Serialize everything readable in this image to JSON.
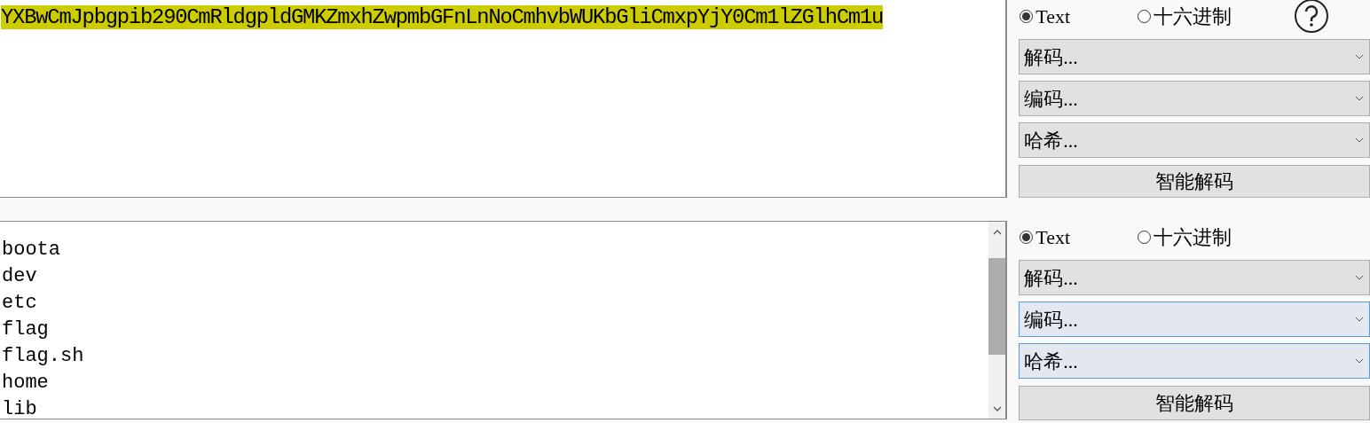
{
  "top_panel": {
    "input_text": "YXBwCmJpbgpib290CmRldgpldGMKZmxhZwpmbGFnLnNoCmhvbWUKbGliCmxpYjY0Cm1lZGlhCm1u",
    "highlighted": true,
    "format_options": [
      {
        "label": "Text",
        "selected": true
      },
      {
        "label": "十六进制",
        "selected": false
      }
    ],
    "dropdowns": [
      {
        "label": "解码...",
        "focused": false
      },
      {
        "label": "编码...",
        "focused": false
      },
      {
        "label": "哈希...",
        "focused": false
      }
    ],
    "smart_decode_button": "智能解码"
  },
  "bottom_panel": {
    "output_lines": [
      "boota",
      "dev",
      "etc",
      "flag",
      "flag.sh",
      "home",
      "lib"
    ],
    "format_options": [
      {
        "label": "Text",
        "selected": true
      },
      {
        "label": "十六进制",
        "selected": false
      }
    ],
    "dropdowns": [
      {
        "label": "解码...",
        "focused": false
      },
      {
        "label": "编码...",
        "focused": true
      },
      {
        "label": "哈希...",
        "focused": true
      }
    ],
    "smart_decode_button": "智能解码"
  }
}
